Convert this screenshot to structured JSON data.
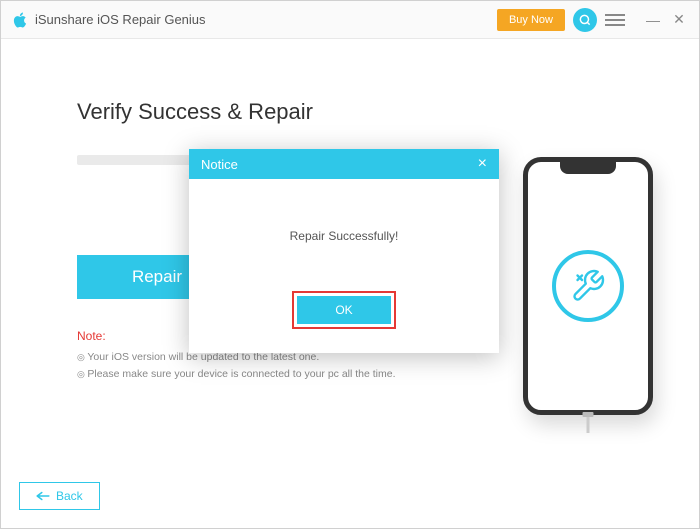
{
  "app": {
    "title": "iSunshare iOS Repair Genius",
    "buyNow": "Buy Now"
  },
  "page": {
    "title": "Verify Success & Repair",
    "repairLabel": "Repair"
  },
  "note": {
    "label": "Note:",
    "item1": "Your iOS version will be updated to the latest one.",
    "item2": "Please make sure your device is connected to your pc all the time."
  },
  "footer": {
    "back": "Back"
  },
  "modal": {
    "title": "Notice",
    "message": "Repair Successfully!",
    "ok": "OK"
  }
}
